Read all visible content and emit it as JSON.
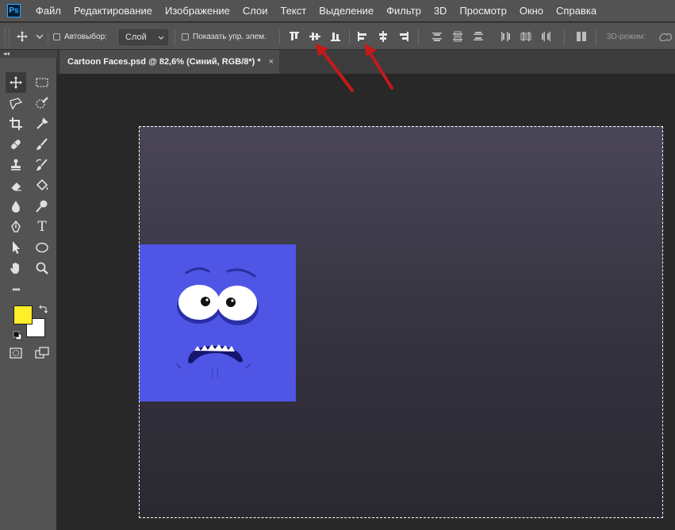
{
  "menubar": {
    "logo": "Ps",
    "items": [
      "Файл",
      "Редактирование",
      "Изображение",
      "Слои",
      "Текст",
      "Выделение",
      "Фильтр",
      "3D",
      "Просмотр",
      "Окно",
      "Справка"
    ]
  },
  "options": {
    "autoselect_label": "Автовыбор:",
    "autoselect_checked": false,
    "autoselect_target": "Слой",
    "show_transform_label": "Показать упр. элем.",
    "show_transform_checked": false,
    "mode_3d_label": "3D-режим:"
  },
  "document": {
    "tab_title": "Cartoon Faces.psd @ 82,6% (Синий, RGB/8*) *",
    "close_glyph": "×"
  },
  "toolbar": {
    "collapse_glyph": "◂◂",
    "more_glyph": "•••",
    "tools": [
      {
        "name": "move-tool",
        "active": true
      },
      {
        "name": "rectangular-marquee-tool"
      },
      {
        "name": "lasso-tool"
      },
      {
        "name": "quick-selection-tool"
      },
      {
        "name": "crop-tool"
      },
      {
        "name": "eyedropper-tool"
      },
      {
        "name": "spot-healing-brush-tool"
      },
      {
        "name": "brush-tool"
      },
      {
        "name": "clone-stamp-tool"
      },
      {
        "name": "history-brush-tool"
      },
      {
        "name": "eraser-tool"
      },
      {
        "name": "paint-bucket-tool"
      },
      {
        "name": "blur-tool"
      },
      {
        "name": "dodge-tool"
      },
      {
        "name": "pen-tool"
      },
      {
        "name": "type-tool"
      },
      {
        "name": "path-selection-tool"
      },
      {
        "name": "ellipse-tool"
      },
      {
        "name": "hand-tool"
      },
      {
        "name": "zoom-tool"
      }
    ],
    "type_glyph": "T"
  },
  "colors": {
    "foreground": "#ffee2a",
    "background": "#ffffff",
    "layer_blue": "#4f56e6",
    "annotation_arrow": "#c41a1a"
  }
}
